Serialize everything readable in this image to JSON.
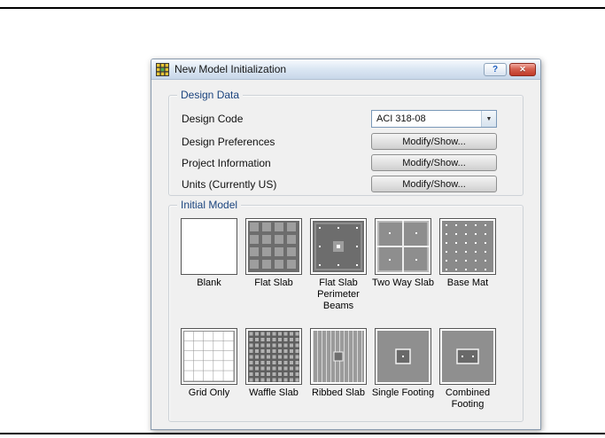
{
  "window": {
    "title": "New Model Initialization"
  },
  "icons": {
    "app": "grid-model-icon",
    "help": "?",
    "close": "✕",
    "dropdown_arrow": "▼"
  },
  "design_data": {
    "group_label": "Design Data",
    "design_code": {
      "label": "Design Code",
      "value": "ACI 318-08"
    },
    "design_preferences": {
      "label": "Design Preferences",
      "button": "Modify/Show..."
    },
    "project_information": {
      "label": "Project Information",
      "button": "Modify/Show..."
    },
    "units": {
      "label": "Units (Currently US)",
      "button": "Modify/Show..."
    }
  },
  "initial_model": {
    "group_label": "Initial Model",
    "templates": [
      {
        "label": "Blank"
      },
      {
        "label": "Flat Slab"
      },
      {
        "label": "Flat Slab Perimeter Beams"
      },
      {
        "label": "Two Way Slab"
      },
      {
        "label": "Base Mat"
      },
      {
        "label": "Grid Only"
      },
      {
        "label": "Waffle Slab"
      },
      {
        "label": "Ribbed Slab"
      },
      {
        "label": "Single Footing"
      },
      {
        "label": "Combined Footing"
      }
    ]
  },
  "colors": {
    "group_label_text": "#1b447e",
    "close_button_red": "#c03a28",
    "dialog_background": "#f0f0f0",
    "slab_dark_gray": "#6d6d6d",
    "slab_mid_gray": "#8f8f8f"
  }
}
